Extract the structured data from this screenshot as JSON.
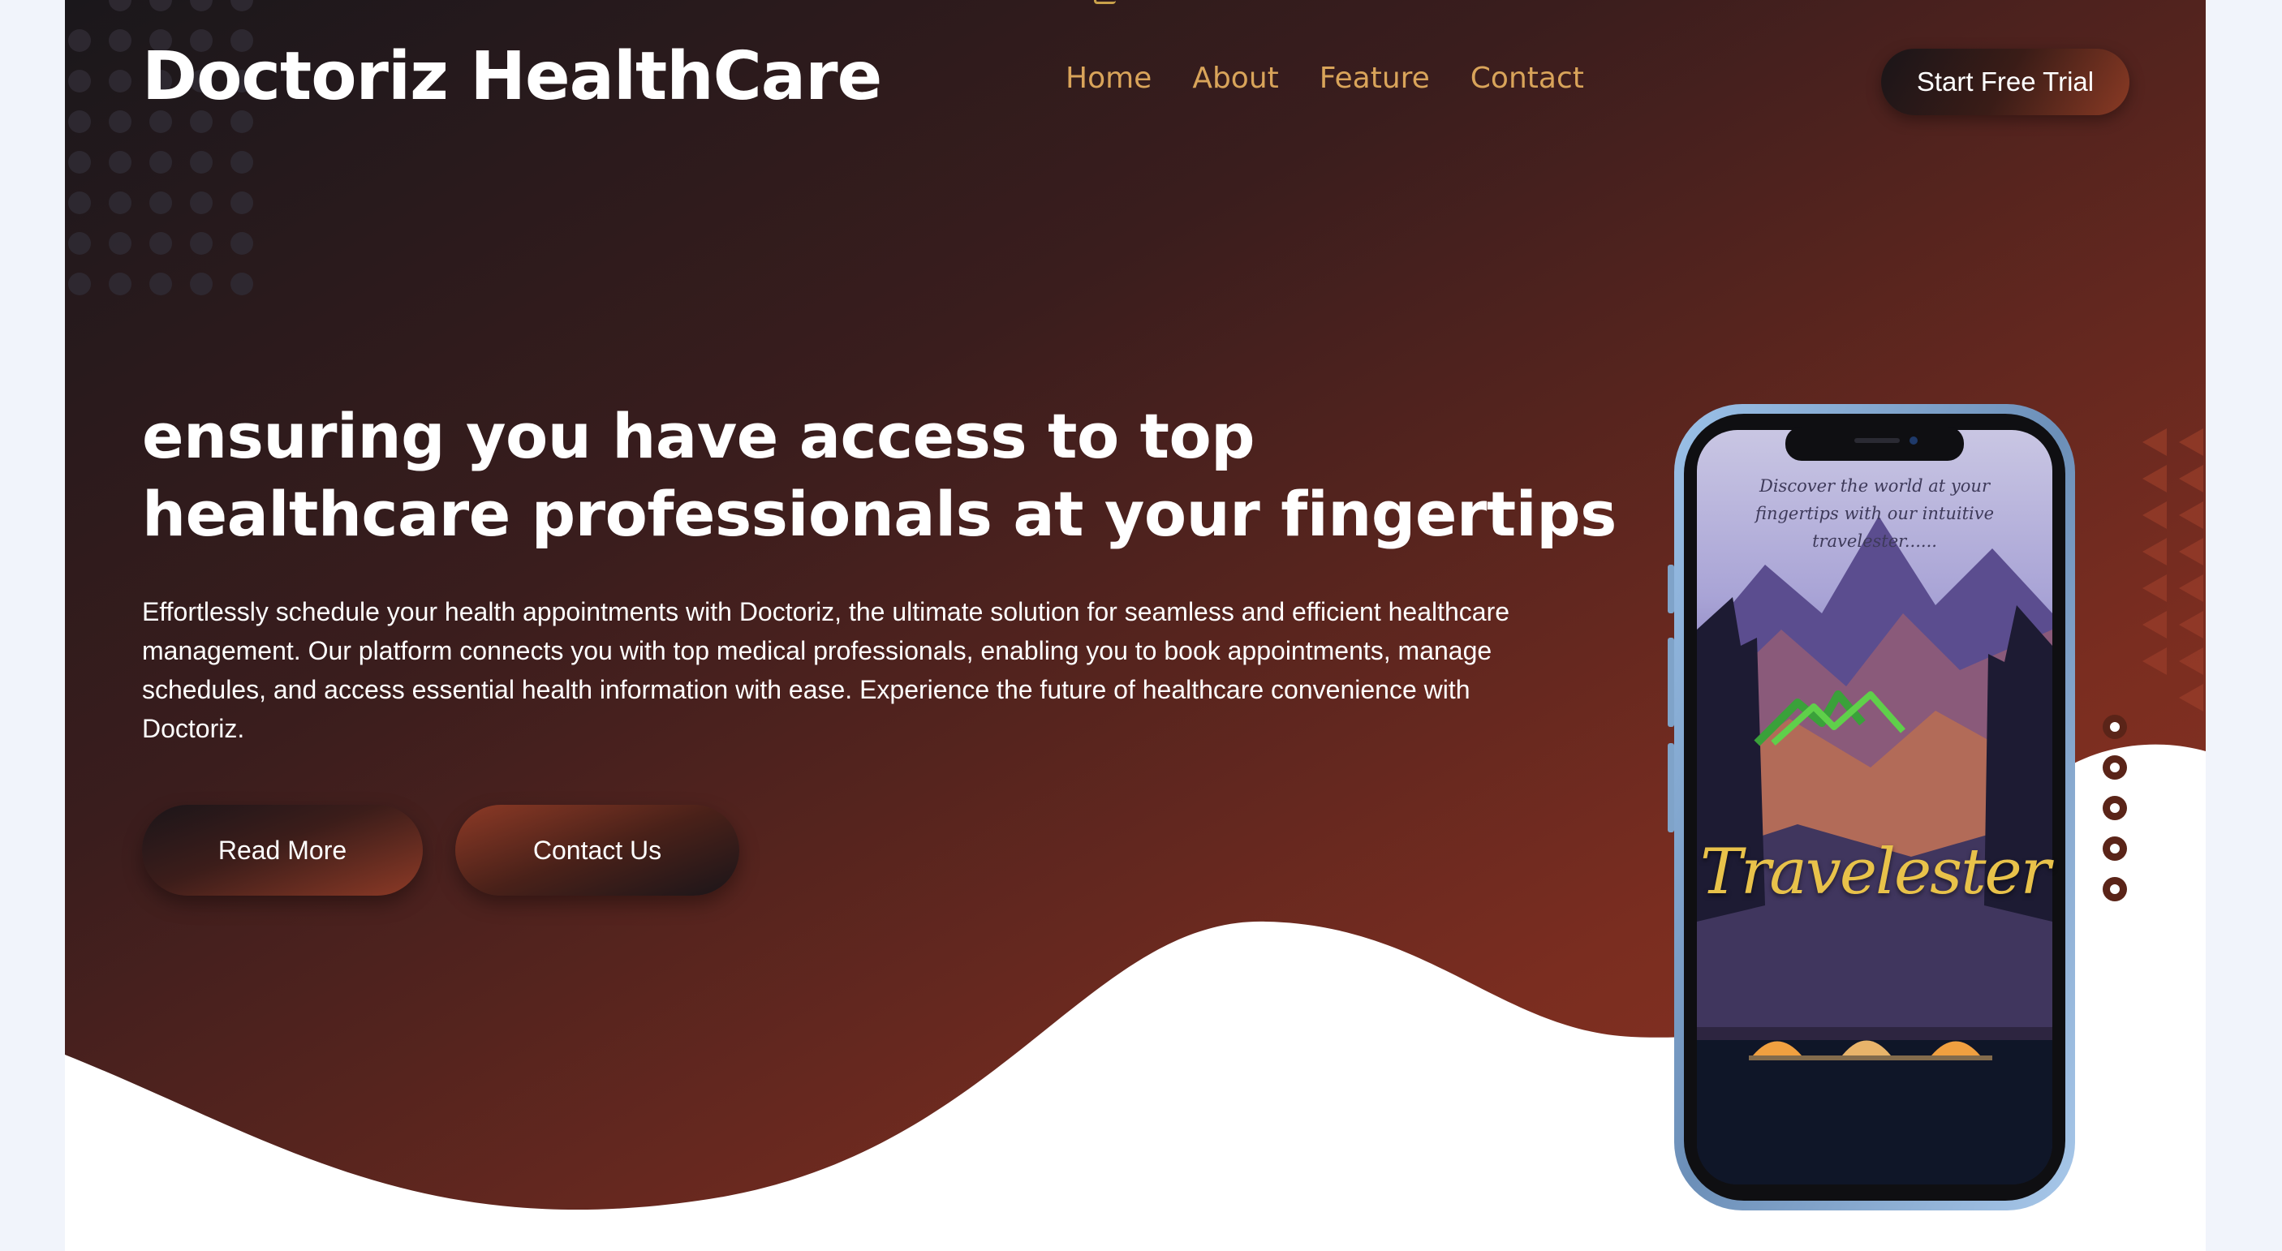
{
  "brand": {
    "name": "Doctoriz HealthCare"
  },
  "nav": {
    "links": [
      {
        "label": "Home"
      },
      {
        "label": "About"
      },
      {
        "label": "Feature"
      },
      {
        "label": "Contact"
      }
    ],
    "cta_label": "Start Free Trial"
  },
  "hero": {
    "headline": "ensuring you have access to top healthcare professionals at your fingertips",
    "description": "Effortlessly schedule your health appointments with Doctoriz, the ultimate solution for seamless and efficient healthcare management. Our platform connects you with top medical professionals, enabling you to book appointments, manage schedules, and access essential health information with ease. Experience the future of healthcare convenience with Doctoriz.",
    "buttons": {
      "read_more": "Read More",
      "contact_us": "Contact Us"
    }
  },
  "phone_mockup": {
    "tagline": "Discover the world at your fingertips with our intuitive travelester......",
    "app_title": "Travelester"
  },
  "slider": {
    "dot_count": 5,
    "active_index": 0
  },
  "colors": {
    "hero_dark": "#1c181d",
    "hero_warm": "#8a3322",
    "nav_link": "#d9a45a",
    "page_bg": "#f1f4fb"
  }
}
